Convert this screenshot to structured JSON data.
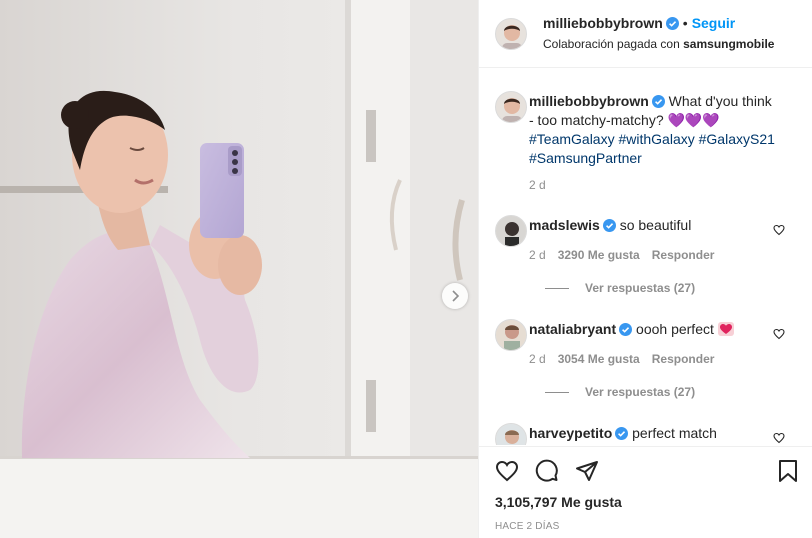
{
  "post": {
    "author": "milliebobbybrown",
    "follow_label": "Seguir",
    "dot": "•",
    "paid_partnership_prefix": "Colaboración pagada con",
    "partner": "samsungmobile",
    "carousel_next_icon": "chevron-right-icon"
  },
  "caption": {
    "username": "milliebobbybrown",
    "text": "What d'you think - too matchy-matchy?",
    "emoji": "💜💜💜",
    "hashtags_line1": "#TeamGalaxy #withGalaxy #GalaxyS21",
    "hashtags_line2": "#SamsungPartner",
    "time": "2 d"
  },
  "comments": [
    {
      "username": "madslewis",
      "text": "so beautiful",
      "time": "2 d",
      "likes": "3290 Me gusta",
      "reply": "Responder",
      "view_replies": "Ver respuestas (27)"
    },
    {
      "username": "nataliabryant",
      "text": "oooh perfect",
      "time": "2 d",
      "likes": "3054 Me gusta",
      "reply": "Responder",
      "view_replies": "Ver respuestas (27)"
    },
    {
      "username": "harveypetito",
      "text": "perfect match"
    }
  ],
  "footer": {
    "likes": "3,105,797 Me gusta",
    "ago": "HACE 2 DÍAS"
  },
  "colors": {
    "accent": "#0095f6",
    "verified": "#3897f0",
    "hashtag": "#00376b",
    "muted": "#8e8e8e",
    "emoji_purple": "#7e57c2"
  }
}
